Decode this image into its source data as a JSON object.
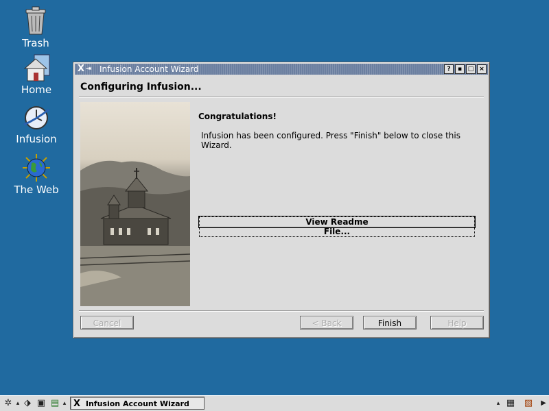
{
  "desktop": {
    "icons": [
      {
        "label": "Trash",
        "icon": "trash-icon"
      },
      {
        "label": "Home",
        "icon": "home-icon"
      },
      {
        "label": "Infusion",
        "icon": "infusion-icon"
      },
      {
        "label": "The Web",
        "icon": "globe-icon"
      }
    ]
  },
  "window": {
    "title": "Infusion Account Wizard",
    "logo": "X",
    "buttons": {
      "help": "?",
      "minimize": "▪",
      "maximize": "□",
      "close": "×"
    },
    "heading": "Configuring Infusion...",
    "congrats": "Congratulations!",
    "info": "Infusion has been configured. Press \"Finish\" below to close this Wizard.",
    "readme_button": "View Readme File...",
    "cancel": "Cancel",
    "back": "< Back",
    "finish": "Finish",
    "help": "Help"
  },
  "taskbar": {
    "task_label": "Infusion Account Wizard",
    "task_logo": "X"
  },
  "colors": {
    "desktop": "#206aa0",
    "window_bg": "#dcdcdc",
    "titlebar": "#6b7fa0"
  }
}
